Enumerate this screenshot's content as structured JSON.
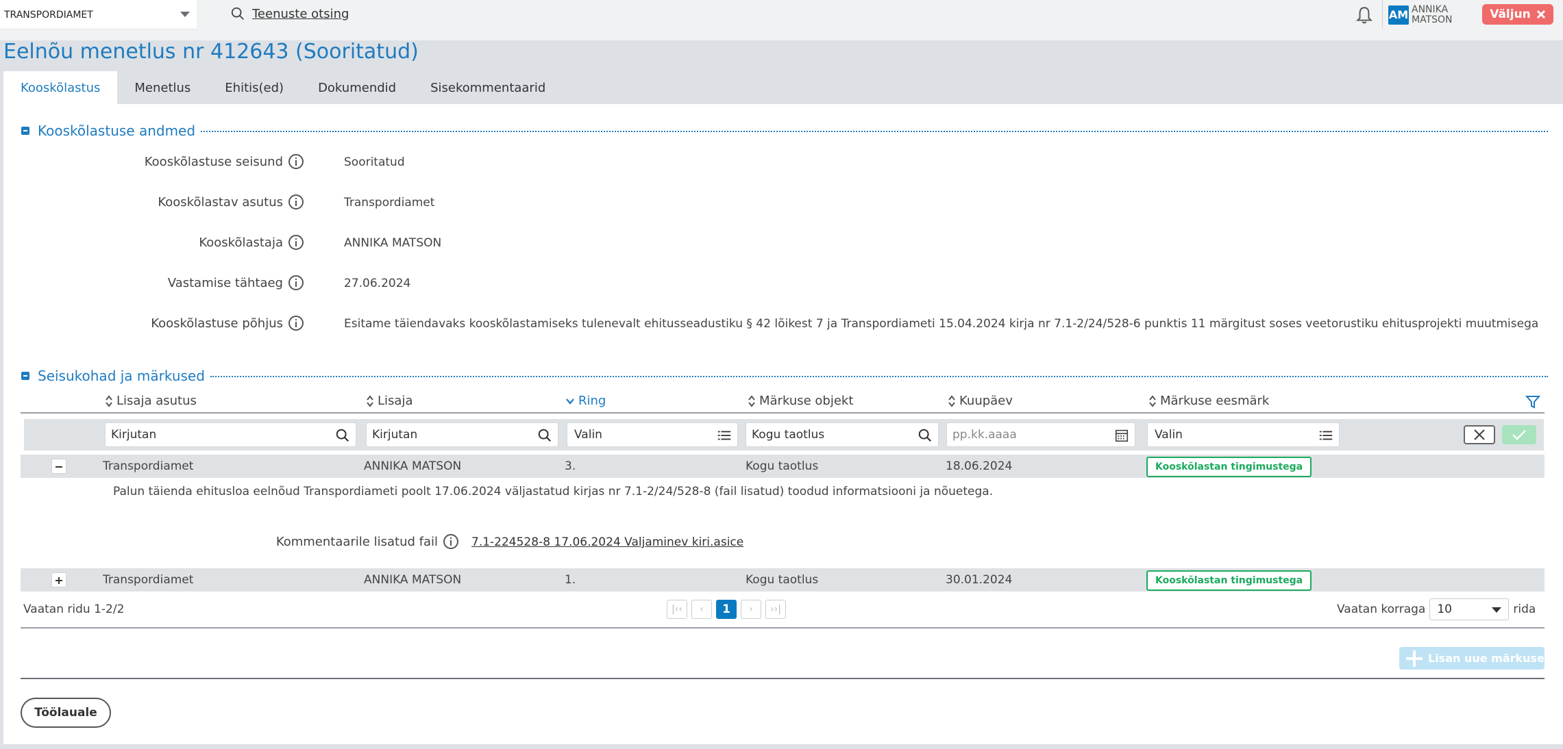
{
  "header": {
    "org": "TRANSPORDIAMET",
    "search_label": "Teenuste otsing",
    "user_initials": "AM",
    "user_first": "ANNIKA",
    "user_last": "MATSON",
    "logout_label": "Väljun"
  },
  "page_title": "Eelnõu menetlus nr 412643 (Sooritatud)",
  "tabs": [
    {
      "label": "Kooskõlastus",
      "active": true
    },
    {
      "label": "Menetlus"
    },
    {
      "label": "Ehitis(ed)"
    },
    {
      "label": "Dokumendid"
    },
    {
      "label": "Sisekommentaarid"
    }
  ],
  "section1": {
    "title": "Kooskõlastuse andmed",
    "fields": [
      {
        "label": "Kooskõlastuse seisund",
        "value": "Sooritatud"
      },
      {
        "label": "Kooskõlastav asutus",
        "value": "Transpordiamet"
      },
      {
        "label": "Kooskõlastaja",
        "value": "ANNIKA MATSON"
      },
      {
        "label": "Vastamise tähtaeg",
        "value": "27.06.2024"
      },
      {
        "label": "Kooskõlastuse põhjus",
        "value": "Esitame täiendavaks kooskõlastamiseks tulenevalt ehitusseadustiku § 42 lõikest 7 ja Transpordiameti 15.04.2024 kirja nr 7.1-2/24/528-6 punktis 11 märgitust soses veetorustiku ehitusprojekti muutmisega"
      }
    ]
  },
  "section2": {
    "title": "Seisukohad ja märkused",
    "columns": [
      "Lisaja asutus",
      "Lisaja",
      "Ring",
      "Märkuse objekt",
      "Kuupäev",
      "Märkuse eesmärk"
    ],
    "filters": {
      "f1": "Kirjutan",
      "f2": "Kirjutan",
      "f3": "Valin",
      "f4": "Kogu taotlus",
      "f5": "pp.kk.aaaa",
      "f6": "Valin"
    },
    "rows": [
      {
        "agency": "Transpordiamet",
        "author": "ANNIKA MATSON",
        "round": "3.",
        "object": "Kogu taotlus",
        "date": "18.06.2024",
        "purpose": "Kooskõlastan tingimustega"
      },
      {
        "agency": "Transpordiamet",
        "author": "ANNIKA MATSON",
        "round": "1.",
        "object": "Kogu taotlus",
        "date": "30.01.2024",
        "purpose": "Kooskõlastan tingimustega"
      }
    ],
    "comment": "Palun täienda ehitusloa eelnõud Transpordiameti poolt 17.06.2024 väljastatud kirjas nr 7.1-2/24/528-8 (fail lisatud) toodud informatsiooni ja nõuetega.",
    "attachment_label": "Kommentaarile lisatud fail",
    "attachment_link": "7.1-224528-8 17.06.2024 Valjaminev kiri.asice",
    "pagination": {
      "summary": "Vaatan ridu 1-2/2",
      "current_page": "1",
      "per_page_label": "Vaatan korraga",
      "per_page": "10",
      "per_page_suffix": "rida"
    },
    "add_label": "Lisan uue märkuse"
  },
  "back_label": "Töölauale"
}
